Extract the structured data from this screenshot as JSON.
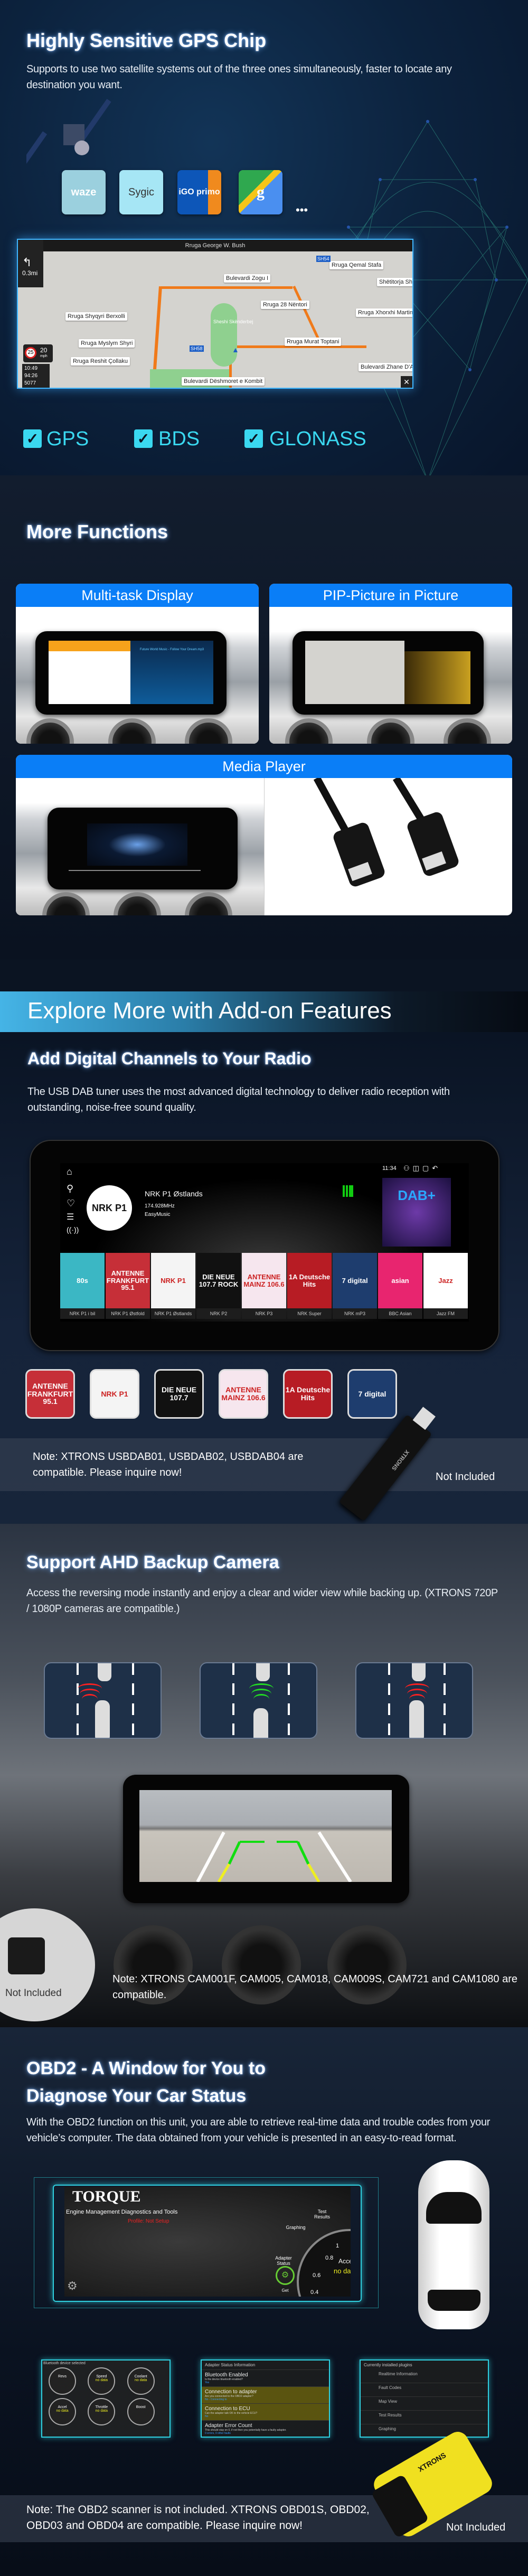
{
  "gps": {
    "title": "Highly Sensitive GPS Chip",
    "description": "Supports to use two satellite systems out of the three ones simultaneously, faster to locate any destination you want.",
    "apps": [
      {
        "name": "waze",
        "label": "waze"
      },
      {
        "name": "sygic",
        "label": "Sygic"
      },
      {
        "name": "igo",
        "label": "iGO primo"
      },
      {
        "name": "google-maps",
        "label": "g"
      }
    ],
    "more": "•••",
    "map": {
      "street": "Rruga George W. Bush",
      "distance": "0.3mi",
      "speed_limit": "25",
      "speed": "20",
      "speed_unit": "mph",
      "eta": "10:49",
      "duration": "94:26",
      "remaining": "5077",
      "labels": [
        "Rruga Qemal Stafa",
        "Bulevardi Zogu I",
        "Shëtitorja Sh",
        "Rruga 28 Nëntori",
        "Rruga Xhorxhi Martini",
        "Rruga Shyqyri Berxolli",
        "Rruga Myslym Shyri",
        "Rruga Murat Toptani",
        "Rruga Reshit Çollaku",
        "Bulevardi Zhane D'Ar",
        "Bulevardi Dëshmoret e Kombit",
        "Sheshi Skënderbej"
      ],
      "shields": [
        "SH54",
        "SH58"
      ]
    },
    "systems": [
      "GPS",
      "BDS",
      "GLONASS"
    ],
    "check_color": "#3ad8f0"
  },
  "more_functions": {
    "title": "More Functions",
    "cards": [
      {
        "label": "Multi-task Display",
        "track": "Future World Music - Follow Your Dream.mp3"
      },
      {
        "label": "PIP-Picture in Picture"
      },
      {
        "label": "Media Player"
      }
    ],
    "accent": "#0a7ef7"
  },
  "addons": {
    "banner": "Explore More with Add-on Features",
    "dab": {
      "title": "Add Digital Channels to Your Radio",
      "description": "The USB DAB tuner uses the most advanced digital technology to deliver radio reception with outstanding, noise-free sound quality.",
      "screen": {
        "time": "11:34",
        "station": "NRK P1 Østlands",
        "frequency": "174.928MHz",
        "genre": "EasyMusic",
        "logo": "NRK P1",
        "dab_logo": "DAB+"
      },
      "stations": [
        {
          "tile": "80s",
          "label": "NRK P1 i bil",
          "color": "#3bb7c4"
        },
        {
          "tile": "ANTENNE FRANKFURT 95.1",
          "label": "NRK P1 Østfold",
          "color": "#c62f38"
        },
        {
          "tile": "NRK P1",
          "label": "NRK P1 Østlands",
          "color": "#f4f4f4"
        },
        {
          "tile": "DIE NEUE 107.7 ROCK",
          "label": "NRK P2",
          "color": "#111"
        },
        {
          "tile": "ANTENNE MAINZ 106.6",
          "label": "NRK P3",
          "color": "#f6e6ee"
        },
        {
          "tile": "1A Deutsche Hits",
          "label": "NRK Super",
          "color": "#b71c24"
        },
        {
          "tile": "7 digital",
          "label": "NRK mP3",
          "color": "#1e3d6e"
        },
        {
          "tile": "asian",
          "label": "BBC Asian",
          "color": "#e8256f"
        },
        {
          "tile": "Jazz",
          "label": "Jazz FM",
          "color": "#fff"
        }
      ],
      "logos": [
        {
          "text": "ANTENNE FRANKFURT 95.1",
          "color": "#c62f38"
        },
        {
          "text": "NRK P1",
          "color": "#f4f4f4"
        },
        {
          "text": "DIE NEUE 107.7",
          "color": "#111"
        },
        {
          "text": "ANTENNE MAINZ 106.6",
          "color": "#f6e6ee"
        },
        {
          "text": "1A Deutsche Hits",
          "color": "#b71c24"
        },
        {
          "text": "7 digital",
          "color": "#1e3d6e"
        }
      ],
      "note": "Note: XTRONS USBDAB01, USBDAB02, USBDAB04 are compatible. Please inquire now!",
      "not_included": "Not Included",
      "dongle_brand": "XTRONS"
    }
  },
  "camera": {
    "title": "Support AHD Backup Camera",
    "description": "Access the reversing mode instantly and enjoy a clear and wider view while backing up. (XTRONS 720P / 1080P cameras are compatible.)",
    "note": "Note: XTRONS CAM001F, CAM005, CAM018, CAM009S, CAM721 and CAM1080 are compatible.",
    "not_included": "Not Included",
    "wave_colors": [
      "#ff2020",
      "#22dd22",
      "#ff2020"
    ]
  },
  "obd2": {
    "title_line1": "OBD2 - A Window for You to",
    "title_line2": "Diagnose Your Car Status",
    "description": "With the OBD2 function on this unit, you are able to retrieve real-time data and trouble codes from your vehicle’s computer. The data obtained from your vehicle is presented in an easy-to-read format.",
    "torque": {
      "title": "TORQUE",
      "subtitle": "Engine Management Diagnostics and Tools",
      "profile": "Profile: Not Setup",
      "menu": [
        "Test Results",
        "Graphing",
        "Adapter Status",
        "Get"
      ],
      "gauge_ticks": [
        "1",
        "0.8",
        "0.6",
        "0.4"
      ],
      "gauge_label": "Acce",
      "gauge_value": "no da"
    },
    "panel1": {
      "header": "Bluetooth device selected",
      "gauges": [
        "Revs",
        "Speed",
        "Coolant",
        "Accel",
        "Throttle",
        "Boost"
      ],
      "status": "no data"
    },
    "panel2": {
      "header": "Adapter Status Information",
      "rows": [
        {
          "title": "Bluetooth Enabled",
          "question": "Is the device bluetooth enabled?",
          "answer": "Yes"
        },
        {
          "title": "Connection to adapter",
          "question": "Are you connected to the OBD2 adapter?",
          "answer": "No - Connecting to"
        },
        {
          "title": "Connection to ECU",
          "question": "Can the adapter talk OK to the vehicle ECU?",
          "answer": "No"
        },
        {
          "title": "Adapter Error Count",
          "question": "This should stay on 0, if not then you potentially have a faulty adapter.",
          "answer": "0 errors, 0 other faults"
        }
      ]
    },
    "panel3": {
      "header": "Currently installed plugins",
      "items": [
        "Realtime Information",
        "Fault Codes",
        "Map View",
        "Test Results",
        "Graphing"
      ]
    },
    "note": "Note: The OBD2 scanner is not included. XTRONS OBD01S, OBD02, OBD03 and OBD04 are compatible. Please inquire now!",
    "not_included": "Not Included",
    "scanner_brand": "XTRONS"
  }
}
